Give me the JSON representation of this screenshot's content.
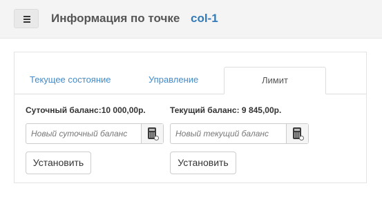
{
  "header": {
    "menu_icon": "hamburger-menu-icon",
    "title": "Информация по точке",
    "point_id": "col-1"
  },
  "tabs": [
    {
      "label": "Текущее состояние",
      "active": false
    },
    {
      "label": "Управление",
      "active": false
    },
    {
      "label": "Лимит",
      "active": true
    }
  ],
  "daily": {
    "label": "Суточный баланс:10 000,00р.",
    "placeholder": "Новый суточный баланс",
    "addon_icon": "calculator-icon",
    "button": "Установить"
  },
  "current": {
    "label": "Текущий баланс: 9 845,00р.",
    "placeholder": "Новый текущий баланс",
    "addon_icon": "calculator-icon",
    "button": "Установить"
  },
  "colors": {
    "link": "#428bca",
    "point_id": "#337ab7",
    "header_bg": "#f4f4f4"
  }
}
